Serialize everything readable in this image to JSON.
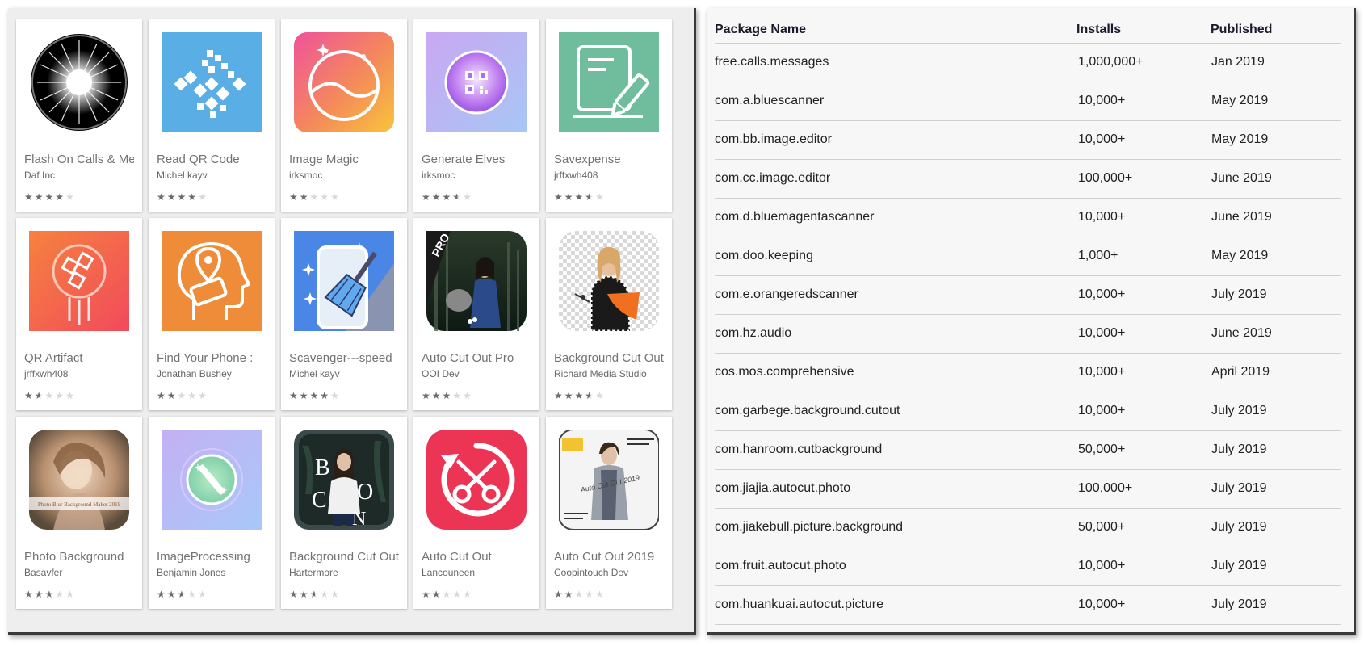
{
  "apps": [
    {
      "title": "Flash On Calls & Messages",
      "developer": "Daf Inc",
      "rating": 4,
      "icon": "flash-burst-icon"
    },
    {
      "title": "Read QR Code",
      "developer": "Michel kayv",
      "rating": 4,
      "icon": "qr-code-icon"
    },
    {
      "title": "Image Magic",
      "developer": "irksmoc",
      "rating": 2,
      "icon": "landscape-circle-icon"
    },
    {
      "title": "Generate Elves",
      "developer": "irksmoc",
      "rating": 3.5,
      "icon": "qr-orb-icon"
    },
    {
      "title": "Savexpense",
      "developer": "jrffxwh408",
      "rating": 3.5,
      "icon": "document-pen-icon"
    },
    {
      "title": "QR Artifact",
      "developer": "jrffxwh408",
      "rating": 1.5,
      "icon": "qr-artifact-icon"
    },
    {
      "title": "Find Your Phone :",
      "developer": "Jonathan Bushey",
      "rating": 2,
      "icon": "head-phone-pin-icon"
    },
    {
      "title": "Scavenger---speed",
      "developer": "Michel kayv",
      "rating": 4,
      "icon": "phone-broom-icon"
    },
    {
      "title": "Auto Cut Out Pro",
      "developer": "OOI Dev",
      "rating": 3,
      "icon": "cutout-pro-photo-icon"
    },
    {
      "title": "Background Cut Out",
      "developer": "Richard Media Studio",
      "rating": 3.5,
      "icon": "cutout-woman-icon"
    },
    {
      "title": "Photo Background",
      "developer": "Basavfer",
      "rating": 3,
      "icon": "blur-portrait-icon"
    },
    {
      "title": "ImageProcessing",
      "developer": "Benjamin Jones",
      "rating": 2.5,
      "icon": "magic-wand-orb-icon"
    },
    {
      "title": "Background Cut Out",
      "developer": "Hartermore",
      "rating": 2.5,
      "icon": "boo-letters-portrait-icon"
    },
    {
      "title": "Auto Cut Out",
      "developer": "Lancouneen",
      "rating": 2,
      "icon": "scissors-circle-icon"
    },
    {
      "title": "Auto Cut Out 2019",
      "developer": "Coopintouch Dev",
      "rating": 2,
      "icon": "autocut-2019-portrait-icon"
    }
  ],
  "icon_texts": {
    "pro_badge": "PRO",
    "boo_letters": [
      "B",
      "O",
      "C",
      "N"
    ],
    "blur_caption": "Photo Blur Background Maker 2019",
    "autocut_caption": "Auto Cut Out 2019"
  },
  "table": {
    "headers": {
      "name": "Package Name",
      "installs": "Installs",
      "published": "Published"
    },
    "rows": [
      {
        "name": "free.calls.messages",
        "installs": "1,000,000+",
        "published": "Jan 2019"
      },
      {
        "name": "com.a.bluescanner",
        "installs": "10,000+",
        "published": "May 2019"
      },
      {
        "name": "com.bb.image.editor",
        "installs": "10,000+",
        "published": "May 2019"
      },
      {
        "name": "com.cc.image.editor",
        "installs": "100,000+",
        "published": "June 2019"
      },
      {
        "name": "com.d.bluemagentascanner",
        "installs": "10,000+",
        "published": "June 2019"
      },
      {
        "name": "com.doo.keeping",
        "installs": "1,000+",
        "published": "May 2019"
      },
      {
        "name": "com.e.orangeredscanner",
        "installs": "10,000+",
        "published": "July 2019"
      },
      {
        "name": "com.hz.audio",
        "installs": "10,000+",
        "published": "June 2019"
      },
      {
        "name": "cos.mos.comprehensive",
        "installs": "10,000+",
        "published": "April 2019"
      },
      {
        "name": "com.garbege.background.cutout",
        "installs": "10,000+",
        "published": "July 2019"
      },
      {
        "name": "com.hanroom.cutbackground",
        "installs": "50,000+",
        "published": "July 2019"
      },
      {
        "name": "com.jiajia.autocut.photo",
        "installs": "100,000+",
        "published": "July 2019"
      },
      {
        "name": "com.jiakebull.picture.background",
        "installs": "50,000+",
        "published": "July 2019"
      },
      {
        "name": "com.fruit.autocut.photo",
        "installs": "10,000+",
        "published": "July 2019"
      },
      {
        "name": "com.huankuai.autocut.picture",
        "installs": "10,000+",
        "published": "July 2019"
      }
    ]
  }
}
